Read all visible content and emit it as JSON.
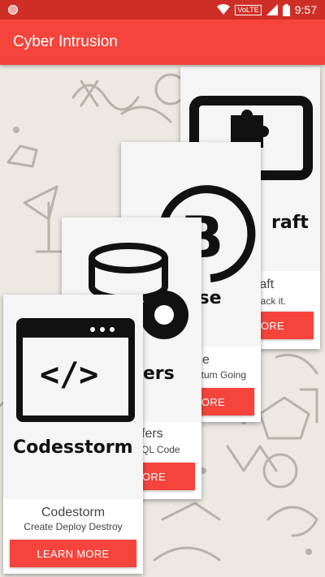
{
  "status_bar": {
    "time": "9:57",
    "volte": "VoLTE",
    "icons": [
      "notification-dot-icon",
      "wifi-icon",
      "signal-icon",
      "battery-icon"
    ]
  },
  "app_bar": {
    "title": "Cyber Intrusion"
  },
  "colors": {
    "primary": "#f4443c",
    "status_bar": "#cf2e26",
    "background": "#ece9e2"
  },
  "cards": [
    {
      "art_text": "raft",
      "title": "raft",
      "subtitle": "hack it.",
      "button": "MORE",
      "icon": "monitor-puzzle-icon"
    },
    {
      "art_text": "lse",
      "title": "se",
      "subtitle": "ntum Going",
      "button": "MORE",
      "icon": "bitcoin-icon"
    },
    {
      "art_text": "ffers",
      "title": "fers",
      "subtitle": "QL Code",
      "button": "MORE",
      "icon": "database-gear-icon"
    },
    {
      "art_text": "Codesstorm",
      "title": "Codestorm",
      "subtitle": "Create Deploy Destroy",
      "button": "LEARN MORE",
      "icon": "code-window-icon"
    }
  ]
}
